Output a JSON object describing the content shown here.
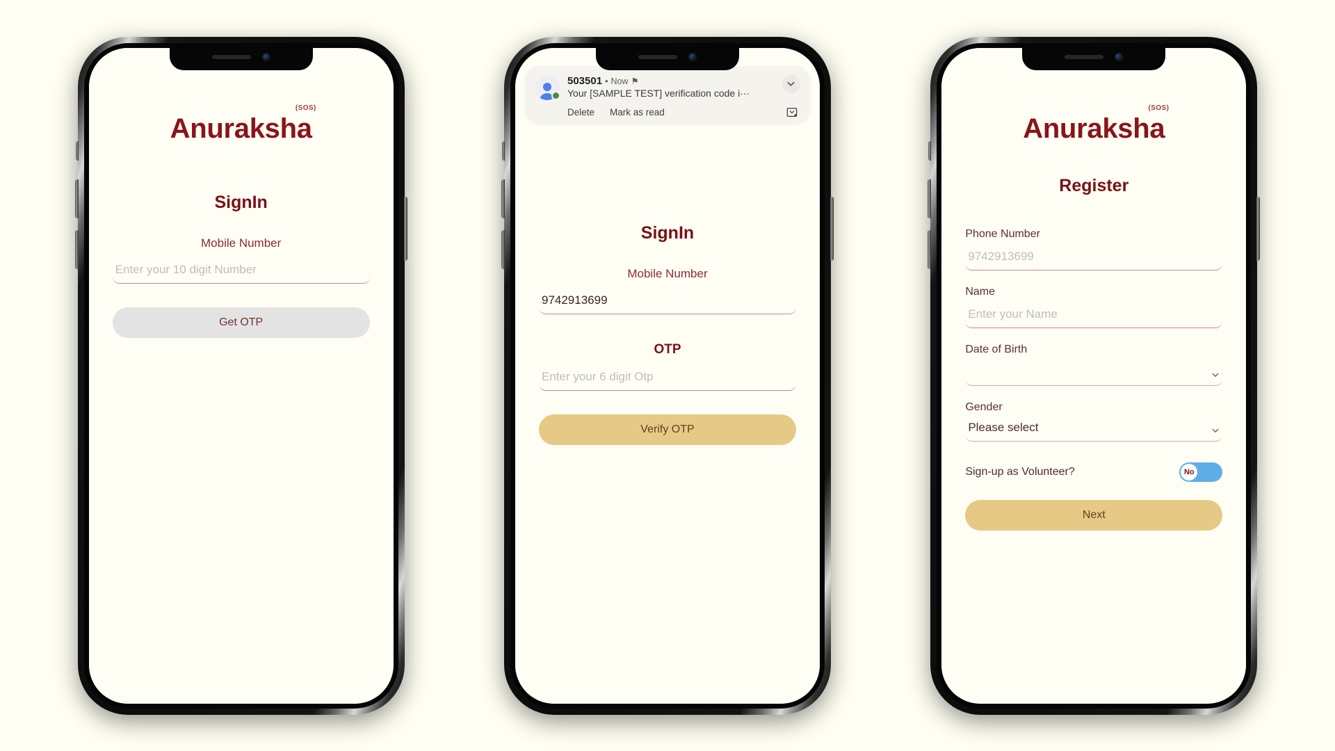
{
  "background_color": "#FFFEF2",
  "brand": {
    "name": "Anuraksha",
    "sos_mark": "(SOS)",
    "color": "#8B1418"
  },
  "phones": [
    {
      "id": "phone-signin-empty",
      "show_brand": true,
      "screen_title": "SignIn",
      "fields": [
        {
          "label": "Mobile Number",
          "placeholder": "Enter your 10 digit Number",
          "value": ""
        }
      ],
      "button": {
        "label": "Get OTP",
        "state": "disabled",
        "bg": "#E3E3E3",
        "color": "#6E3338"
      }
    },
    {
      "id": "phone-signin-otp",
      "show_brand": false,
      "screen_title": "SignIn",
      "notification": {
        "sender": "503501",
        "separator": "•",
        "time": "Now",
        "app_icon": "message-icon",
        "message": "Your [SAMPLE TEST] verification code i···",
        "actions": [
          "Delete",
          "Mark as read"
        ],
        "expand_icon": "chevron-down-icon",
        "reply_icon": "reply-inline-icon"
      },
      "fields": [
        {
          "label": "Mobile Number",
          "placeholder": "",
          "value": "9742913699"
        },
        {
          "label": "OTP",
          "placeholder": "Enter your 6 digit Otp",
          "value": ""
        }
      ],
      "button": {
        "label": "Verify OTP",
        "state": "primary",
        "bg": "#E6C984",
        "color": "#6B3B20"
      }
    },
    {
      "id": "phone-register",
      "show_brand": true,
      "screen_title": "Register",
      "fields": [
        {
          "label": "Phone Number",
          "placeholder": "9742913699",
          "value": ""
        },
        {
          "label": "Name",
          "placeholder": "Enter your Name",
          "value": ""
        },
        {
          "label": "Date of Birth",
          "value": "",
          "type": "date-select",
          "icon": "chevron-down-icon"
        },
        {
          "label": "Gender",
          "value": "Please select",
          "type": "select",
          "icon": "chevron-down-icon"
        }
      ],
      "toggle": {
        "label": "Sign-up as Volunteer?",
        "value": "No",
        "on_color": "#5EAEE8"
      },
      "button": {
        "label": "Next",
        "state": "primary",
        "bg": "#E6C984",
        "color": "#6B3B20"
      }
    }
  ]
}
